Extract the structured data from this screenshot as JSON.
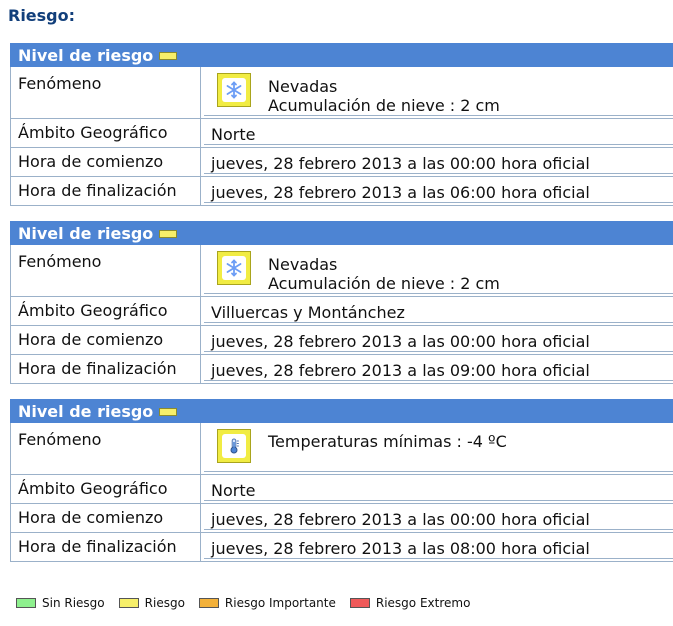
{
  "page": {
    "title": "Riesgo:"
  },
  "legend": [
    {
      "label": "Sin Riesgo",
      "color": "#8ef08e"
    },
    {
      "label": "Riesgo",
      "color": "#f6ef6a"
    },
    {
      "label": "Riesgo Importante",
      "color": "#f3b13a"
    },
    {
      "label": "Riesgo Extremo",
      "color": "#ef5a5a"
    }
  ],
  "alerts": [
    {
      "header": "Nivel de riesgo",
      "level_color": "#f6ef6a",
      "rows": {
        "phenomenon_label": "Fenómeno",
        "phenomenon_icon": "snowflake-icon",
        "phenomenon_line1": "Nevadas",
        "phenomenon_line2": "Acumulación de nieve : 2 cm",
        "area_label": "Ámbito Geográfico",
        "area_value": "Norte",
        "start_label": "Hora de comienzo",
        "start_value": "jueves, 28 febrero 2013 a las 00:00 hora oficial",
        "end_label": "Hora de finalización",
        "end_value": "jueves, 28 febrero 2013 a las 06:00 hora oficial"
      }
    },
    {
      "header": "Nivel de riesgo",
      "level_color": "#f6ef6a",
      "rows": {
        "phenomenon_label": "Fenómeno",
        "phenomenon_icon": "snowflake-icon",
        "phenomenon_line1": "Nevadas",
        "phenomenon_line2": "Acumulación de nieve : 2 cm",
        "area_label": "Ámbito Geográfico",
        "area_value": "Villuercas y Montánchez",
        "start_label": "Hora de comienzo",
        "start_value": "jueves, 28 febrero 2013 a las 00:00 hora oficial",
        "end_label": "Hora de finalización",
        "end_value": "jueves, 28 febrero 2013 a las 09:00 hora oficial"
      }
    },
    {
      "header": "Nivel de riesgo",
      "level_color": "#f6ef6a",
      "rows": {
        "phenomenon_label": "Fenómeno",
        "phenomenon_icon": "thermometer-icon",
        "phenomenon_line1": "Temperaturas mínimas : -4 ºC",
        "phenomenon_line2": "",
        "area_label": "Ámbito Geográfico",
        "area_value": "Norte",
        "start_label": "Hora de comienzo",
        "start_value": "jueves, 28 febrero 2013 a las 00:00 hora oficial",
        "end_label": "Hora de finalización",
        "end_value": "jueves, 28 febrero 2013 a las 08:00 hora oficial"
      }
    }
  ]
}
